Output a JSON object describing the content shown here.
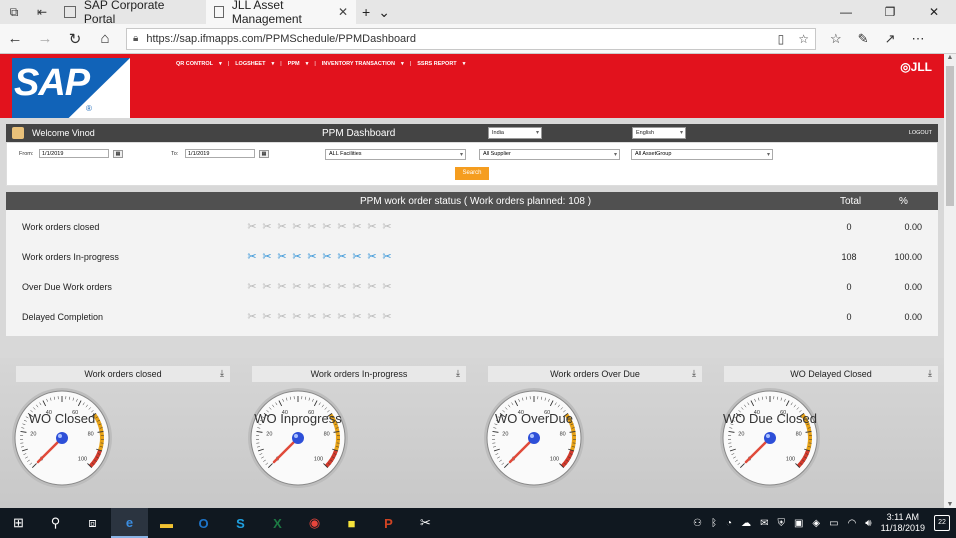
{
  "browser": {
    "tabs": [
      {
        "title": "SAP Corporate Portal",
        "active": false
      },
      {
        "title": "JLL Asset Management",
        "active": true
      }
    ],
    "url": "https://sap.ifmapps.com/PPMSchedule/PPMDashboard"
  },
  "header": {
    "logo_text": "SAP",
    "logo_reg": "®",
    "brand_right": "◎JLL",
    "menu": [
      "QR CONTROL",
      "LOGSHEET",
      "PPM",
      "INVENTORY TRANSACTION",
      "SSRS REPORT"
    ]
  },
  "topbar": {
    "welcome": "Welcome Vinod",
    "title": "PPM Dashboard",
    "country": "India",
    "language": "English",
    "logout": "LOGOUT"
  },
  "filters": {
    "from_label": "From:",
    "from_value": "1/1/2019",
    "to_label": "To:",
    "to_value": "1/1/2019",
    "facility": "ALL Facilities",
    "supplier": "All Supplier",
    "asset_group": "All AssetGroup",
    "search_label": "Search"
  },
  "status": {
    "title": "PPM work order status ( Work orders planned: 108 )",
    "total_header": "Total",
    "pct_header": "%",
    "rows": [
      {
        "label": "Work orders closed",
        "total": "0",
        "pct": "0.00",
        "active": false
      },
      {
        "label": "Work orders In-progress",
        "total": "108",
        "pct": "100.00",
        "active": true
      },
      {
        "label": "Over Due Work orders",
        "total": "0",
        "pct": "0.00",
        "active": false
      },
      {
        "label": "Delayed Completion",
        "total": "0",
        "pct": "0.00",
        "active": false
      }
    ]
  },
  "gauges": [
    {
      "panel": "Work orders closed",
      "label": "WO Closed",
      "value": 0
    },
    {
      "panel": "Work orders In-progress",
      "label": "WO Inprogress",
      "value": 0
    },
    {
      "panel": "Work orders Over Due",
      "label": "WO OverDue",
      "value": 0
    },
    {
      "panel": "WO Delayed Closed",
      "label": "WO Due Closed",
      "value": 0
    }
  ],
  "gauge_ticks": [
    "0",
    "20",
    "40",
    "60",
    "80",
    "100"
  ],
  "taskbar": {
    "time": "3:11 AM",
    "date": "11/18/2019",
    "notifications": "22"
  }
}
